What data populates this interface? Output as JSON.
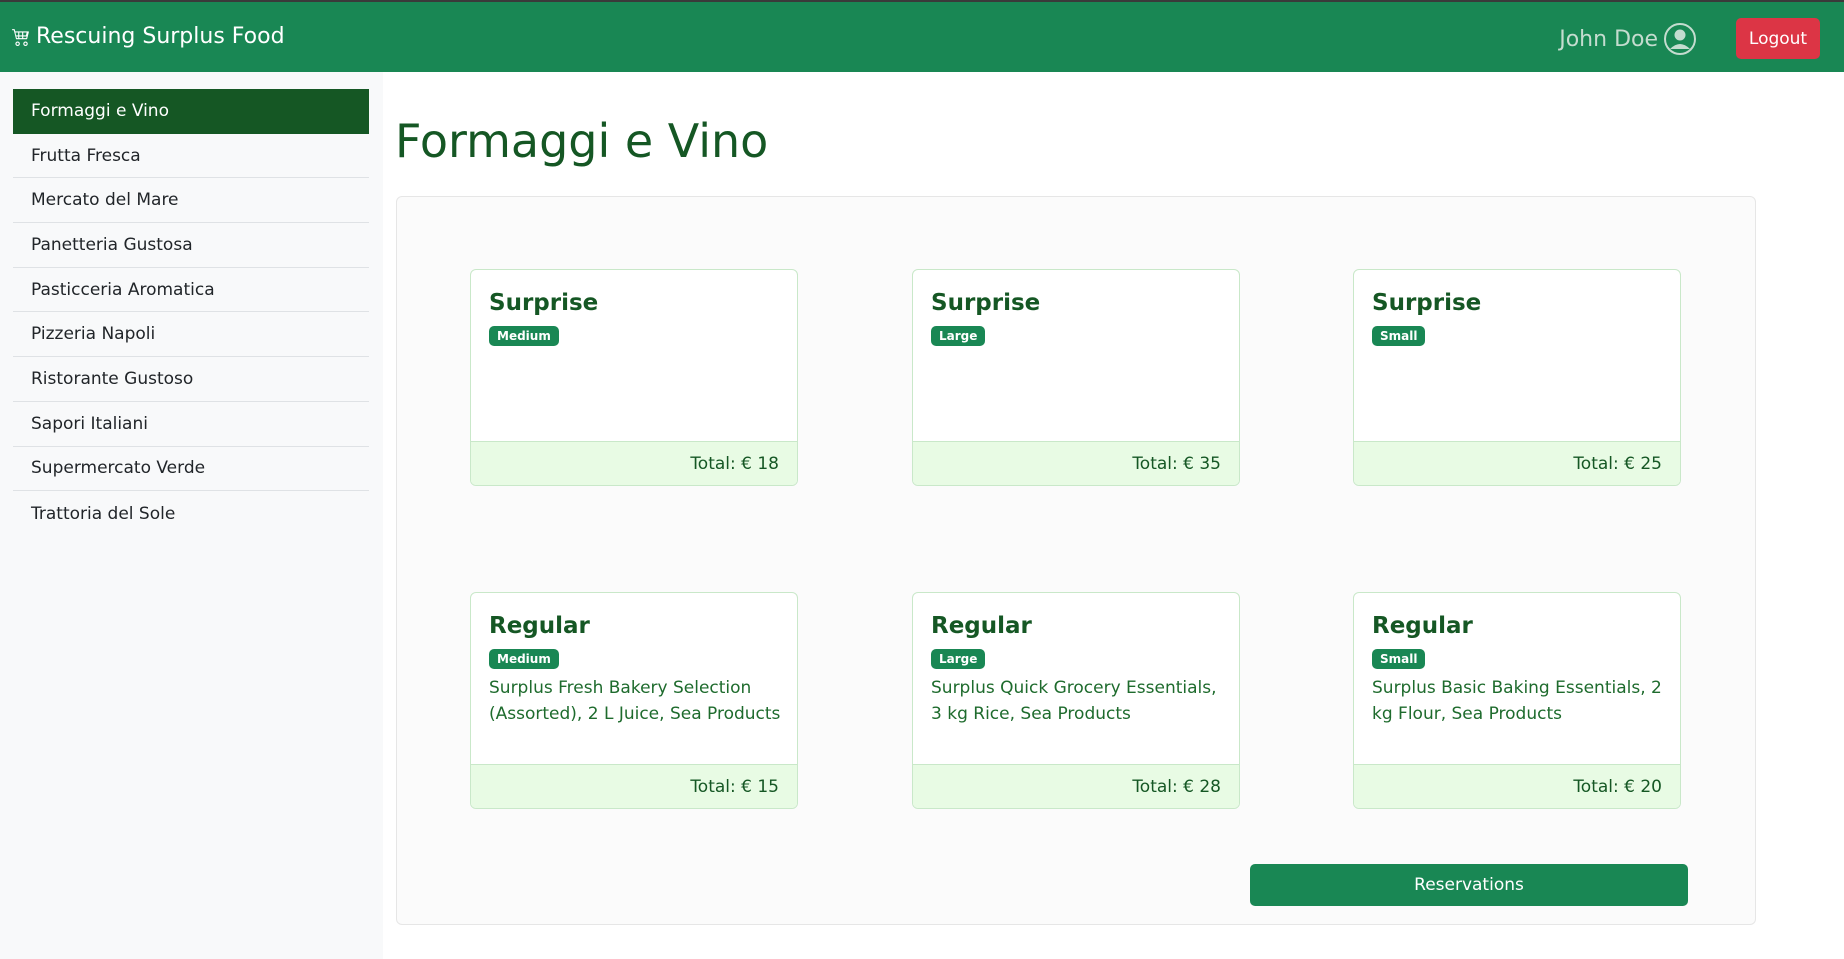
{
  "brand": {
    "title": "Rescuing Surplus Food",
    "icon": "shopping-cart-icon"
  },
  "user": {
    "name": "John Doe",
    "icon": "user-circle-icon"
  },
  "logout_label": "Logout",
  "sidebar": {
    "items": [
      {
        "label": "Formaggi e Vino",
        "active": true
      },
      {
        "label": "Frutta Fresca"
      },
      {
        "label": "Mercato del Mare"
      },
      {
        "label": "Panetteria Gustosa"
      },
      {
        "label": "Pasticceria Aromatica"
      },
      {
        "label": "Pizzeria Napoli"
      },
      {
        "label": "Ristorante Gustoso"
      },
      {
        "label": "Sapori Italiani"
      },
      {
        "label": "Supermercato Verde"
      },
      {
        "label": "Trattoria del Sole"
      }
    ]
  },
  "page_title": "Formaggi e Vino",
  "cards": [
    {
      "title": "Surprise",
      "size": "Medium",
      "contents": "",
      "total": "Total: € 18"
    },
    {
      "title": "Surprise",
      "size": "Large",
      "contents": "",
      "total": "Total: € 35"
    },
    {
      "title": "Surprise",
      "size": "Small",
      "contents": "",
      "total": "Total: € 25"
    },
    {
      "title": "Regular",
      "size": "Medium",
      "contents": "Surplus Fresh Bakery Selection (Assorted), 2 L Juice, Sea Products",
      "total": "Total: € 15"
    },
    {
      "title": "Regular",
      "size": "Large",
      "contents": "Surplus Quick Grocery Essentials, 3 kg Rice, Sea Products",
      "total": "Total: € 28"
    },
    {
      "title": "Regular",
      "size": "Small",
      "contents": "Surplus Basic Baking Essentials, 2 kg Flour, Sea Products",
      "total": "Total: € 20"
    }
  ],
  "reservations_label": "Reservations",
  "colors": {
    "primary": "#198754",
    "dark_green": "#155724",
    "danger": "#dc3545",
    "footer_bg": "#e8fbe4"
  }
}
